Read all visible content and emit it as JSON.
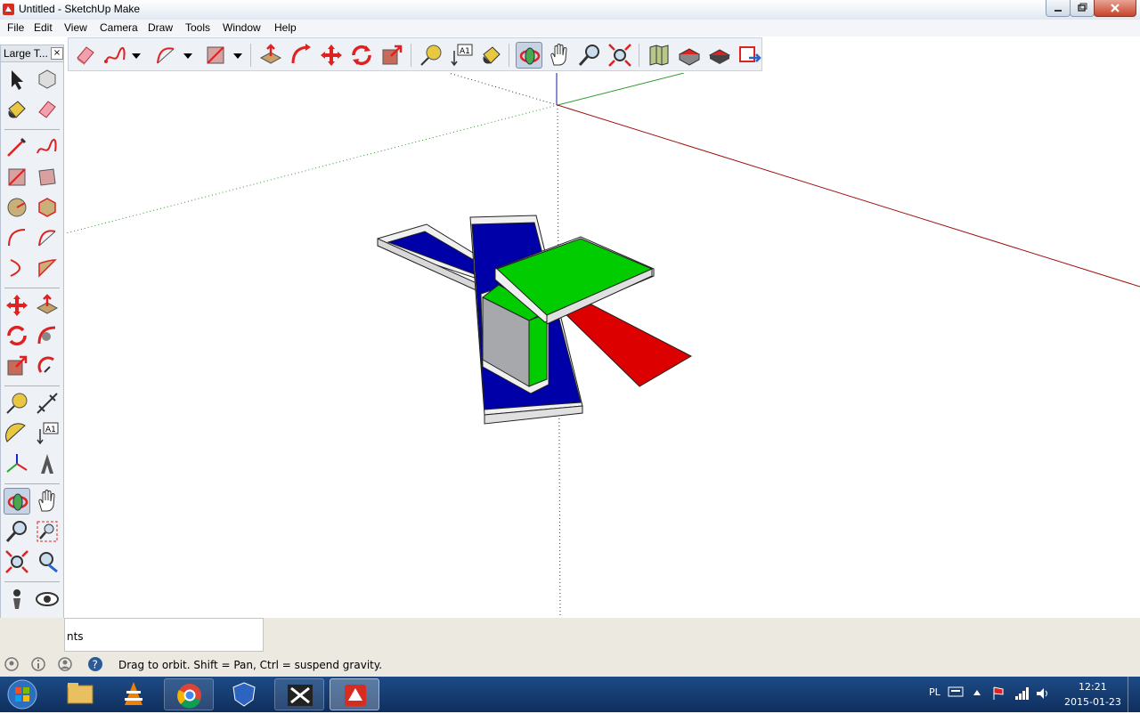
{
  "window": {
    "title": "Untitled - SketchUp Make"
  },
  "menu": [
    "File",
    "Edit",
    "View",
    "Camera",
    "Draw",
    "Tools",
    "Window",
    "Help"
  ],
  "left_toolbar": {
    "title": "Large T...",
    "close": "×"
  },
  "measurements": {
    "label": "nts"
  },
  "status": {
    "text": "Drag to orbit. Shift = Pan, Ctrl = suspend gravity."
  },
  "tray": {
    "lang": "PL",
    "time": "12:21",
    "date": "2015-01-23"
  },
  "colors": {
    "blue_face": "#0000a8",
    "green_face": "#00cc00",
    "red_face": "#dd0000",
    "gray_face": "#a6a8ab",
    "taskbar": "#1d4b86"
  }
}
